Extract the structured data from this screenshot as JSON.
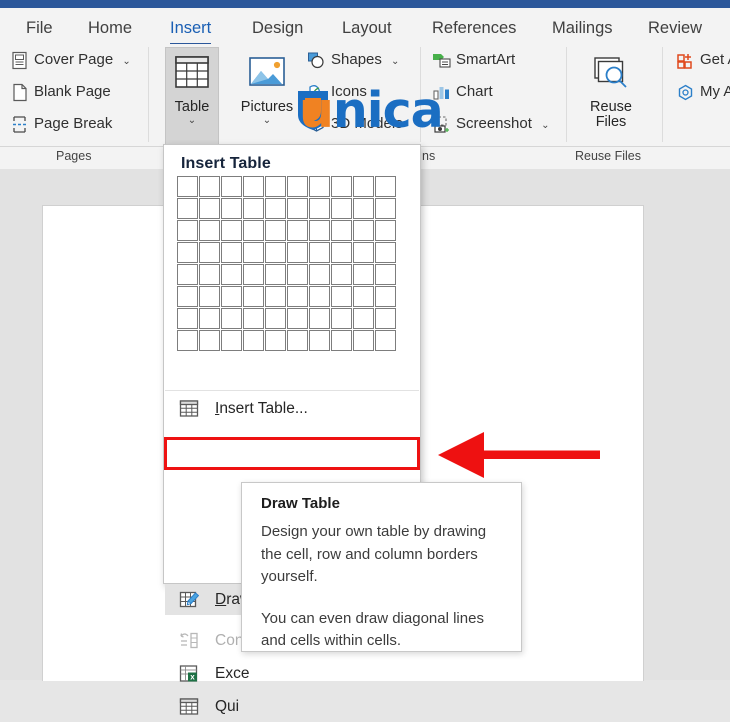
{
  "window": {
    "app": "Microsoft Word"
  },
  "ribbon": {
    "tabs": [
      {
        "label": "File",
        "active": false
      },
      {
        "label": "Home",
        "active": false
      },
      {
        "label": "Insert",
        "active": true
      },
      {
        "label": "Design",
        "active": false
      },
      {
        "label": "Layout",
        "active": false
      },
      {
        "label": "References",
        "active": false
      },
      {
        "label": "Mailings",
        "active": false
      },
      {
        "label": "Review",
        "active": false
      }
    ],
    "groups": [
      {
        "label": "Pages"
      },
      {
        "label": "ns"
      },
      {
        "label": "Reuse Files"
      }
    ],
    "pages_commands": [
      {
        "label": "Cover Page",
        "icon": "cover-page-icon",
        "chevron": "⌄"
      },
      {
        "label": "Blank Page",
        "icon": "blank-page-icon",
        "chevron": ""
      },
      {
        "label": "Page Break",
        "icon": "page-break-icon",
        "chevron": ""
      }
    ],
    "table_button": {
      "label": "Table",
      "chevron": "⌄",
      "icon": "table-icon",
      "state": "pressed"
    },
    "pictures_button": {
      "label": "Pictures",
      "chevron": "⌄",
      "icon": "pictures-icon"
    },
    "illustration_commands": [
      {
        "label": "Shapes",
        "icon": "shapes-icon",
        "chevron": "⌄"
      },
      {
        "label": "Icons",
        "icon": "icons-icon",
        "chevron": ""
      },
      {
        "label": "3D Models",
        "icon": "3d-models-icon",
        "chevron": ""
      },
      {
        "label": "SmartArt",
        "icon": "smartart-icon",
        "chevron": ""
      },
      {
        "label": "Chart",
        "icon": "chart-icon",
        "chevron": ""
      },
      {
        "label": "Screenshot",
        "icon": "screenshot-icon",
        "chevron": "⌄"
      }
    ],
    "reuse_files_button": {
      "line1": "Reuse",
      "line2": "Files",
      "icon": "reuse-files-icon"
    },
    "addins_commands": [
      {
        "label": "Get A",
        "icon": "get-addins-icon"
      },
      {
        "label": "My A",
        "icon": "my-addins-icon"
      }
    ]
  },
  "table_menu": {
    "title": "Insert Table",
    "grid": {
      "columns": 10,
      "rows": 8
    },
    "items": [
      {
        "label": "Insert Table...",
        "underline_index": 0,
        "icon": "insert-table-icon",
        "state": "normal"
      },
      {
        "label": "Draw Table",
        "underline_index": 0,
        "icon": "draw-table-icon",
        "state": "selected"
      },
      {
        "label": "Con",
        "underline_index": -1,
        "icon": "convert-text-icon",
        "state": "disabled"
      },
      {
        "label": "Exce",
        "underline_index": 2,
        "icon": "excel-spreadsheet-icon",
        "state": "normal"
      },
      {
        "label": "Qui",
        "underline_index": -1,
        "icon": "quick-tables-icon",
        "state": "normal"
      }
    ]
  },
  "tooltip": {
    "title": "Draw Table",
    "paragraph1": "Design your own table by drawing the cell, row and column borders yourself.",
    "paragraph2": "You can even draw diagonal lines and cells within cells."
  },
  "annotation": {
    "arrow": "left-pointing-red-arrow",
    "highlight_box": "red-rectangle-around-draw-table"
  },
  "watermark": {
    "text_first": "u",
    "text_rest": "nica"
  },
  "colors": {
    "accent_blue": "#2b579a",
    "active_tab": "#1a5fb4",
    "ribbon_bg": "#f3f3f3",
    "canvas_bg": "#e2e2e2",
    "annotation_red": "#ee1111",
    "watermark_orange": "#f08222",
    "watermark_blue": "#1b6ec2"
  }
}
